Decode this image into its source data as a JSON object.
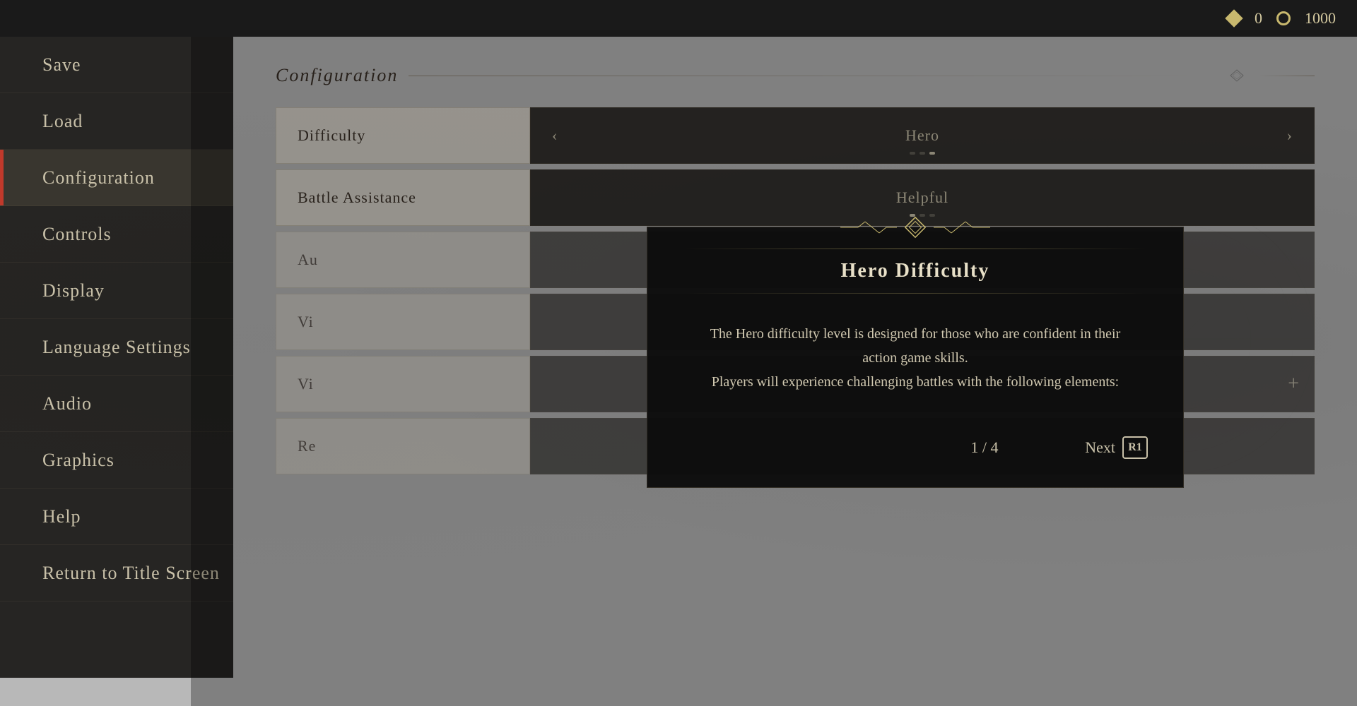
{
  "topbar": {
    "currency1_value": "0",
    "currency2_value": "1000"
  },
  "sidebar": {
    "items": [
      {
        "id": "save",
        "label": "Save",
        "active": false
      },
      {
        "id": "load",
        "label": "Load",
        "active": false
      },
      {
        "id": "configuration",
        "label": "Configuration",
        "active": true
      },
      {
        "id": "controls",
        "label": "Controls",
        "active": false
      },
      {
        "id": "display",
        "label": "Display",
        "active": false
      },
      {
        "id": "language-settings",
        "label": "Language Settings",
        "active": false
      },
      {
        "id": "audio",
        "label": "Audio",
        "active": false
      },
      {
        "id": "graphics",
        "label": "Graphics",
        "active": false
      },
      {
        "id": "help",
        "label": "Help",
        "active": false
      },
      {
        "id": "return-to-title",
        "label": "Return to Title Screen",
        "active": false
      }
    ]
  },
  "page": {
    "title": "Configuration"
  },
  "config_rows": [
    {
      "label": "Difficulty",
      "value": "Hero",
      "type": "selector",
      "dots": [
        false,
        false,
        true
      ]
    },
    {
      "label": "Battle Assistance",
      "value": "Helpful",
      "type": "selector",
      "dots": [
        true,
        false,
        false
      ]
    },
    {
      "label": "Au",
      "value": "",
      "type": "partial"
    },
    {
      "label": "Vi",
      "value": "",
      "type": "partial"
    },
    {
      "label": "Vi",
      "value": "+",
      "type": "partial-plus"
    },
    {
      "label": "Re",
      "value": "",
      "type": "partial"
    }
  ],
  "modal": {
    "title": "Hero Difficulty",
    "body_line1": "The Hero difficulty level is designed for those who are confident in their action game skills.",
    "body_line2": "Players will experience challenging battles with the following elements:",
    "page_current": "1",
    "page_total": "4",
    "next_label": "Next",
    "next_button": "R1"
  }
}
